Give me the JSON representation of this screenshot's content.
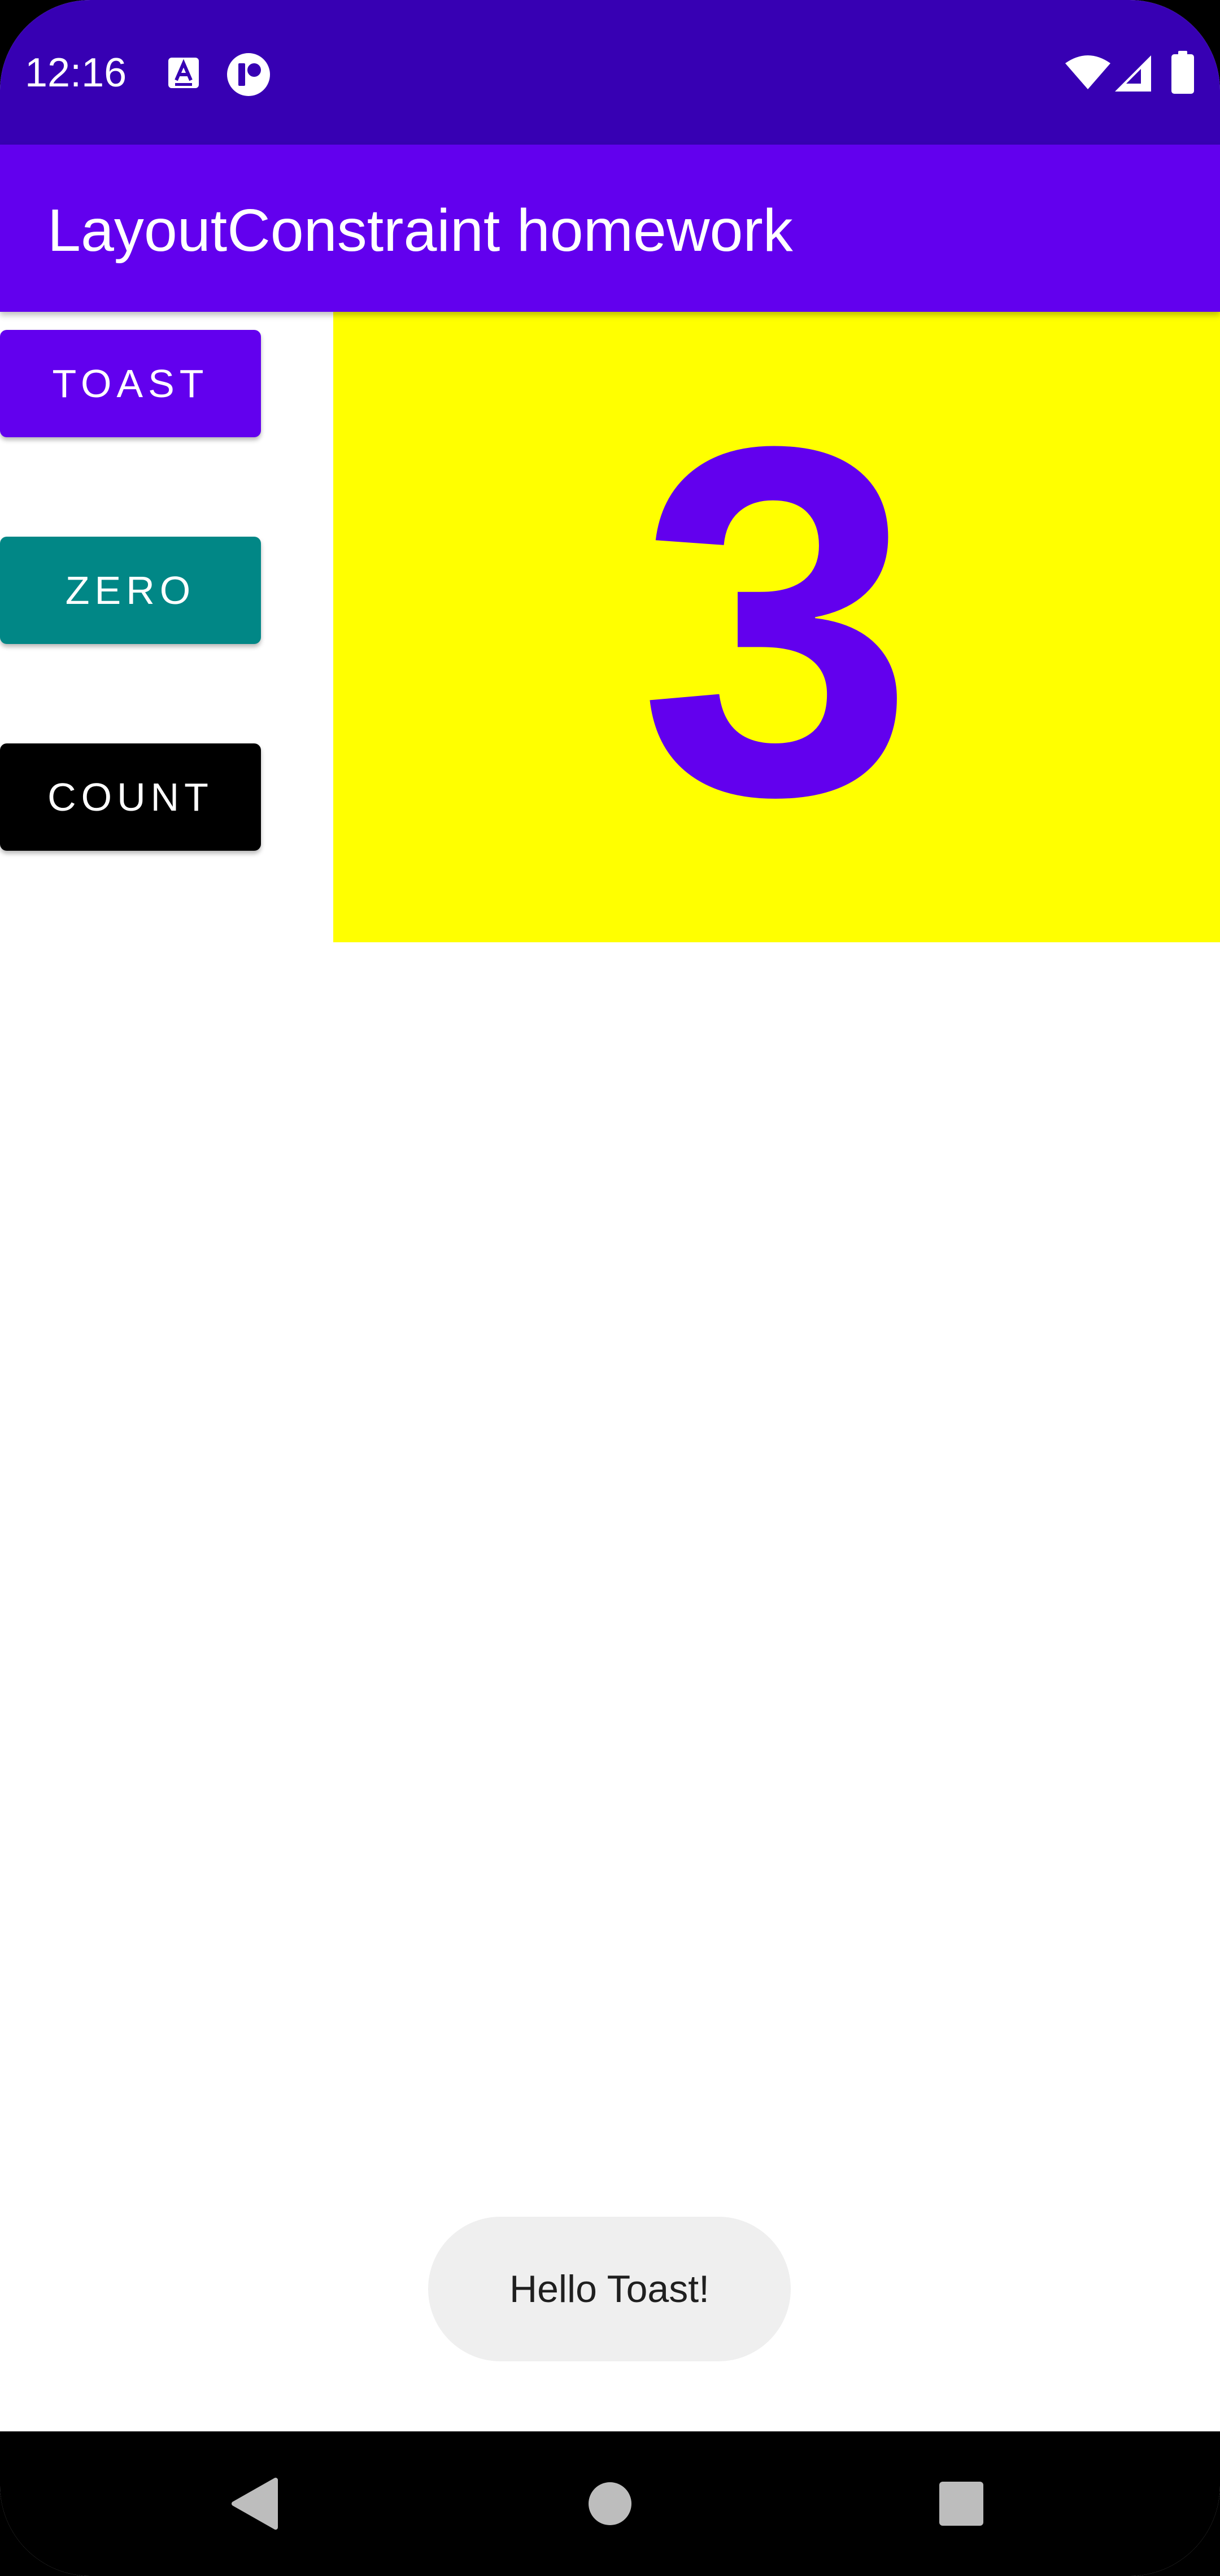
{
  "status_bar": {
    "time": "12:16",
    "background": "#3700B3",
    "left_icons": [
      "keyboard-a-icon",
      "record-icon"
    ],
    "right_icons": [
      "wifi-icon",
      "cellular-signal-icon",
      "battery-icon"
    ]
  },
  "app_bar": {
    "title": "LayoutConstraint homework",
    "background": "#6200EE"
  },
  "buttons": {
    "toast": {
      "label": "TOAST",
      "color": "#6200EE"
    },
    "zero": {
      "label": "ZERO",
      "color": "#018786"
    },
    "count": {
      "label": "COUNT",
      "color": "#000000"
    }
  },
  "counter": {
    "value": "3",
    "background": "#FFFF00",
    "text_color": "#6200EE"
  },
  "toast": {
    "message": "Hello Toast!"
  },
  "nav_bar": {
    "icons": [
      "back-icon",
      "home-icon",
      "recents-icon"
    ]
  }
}
